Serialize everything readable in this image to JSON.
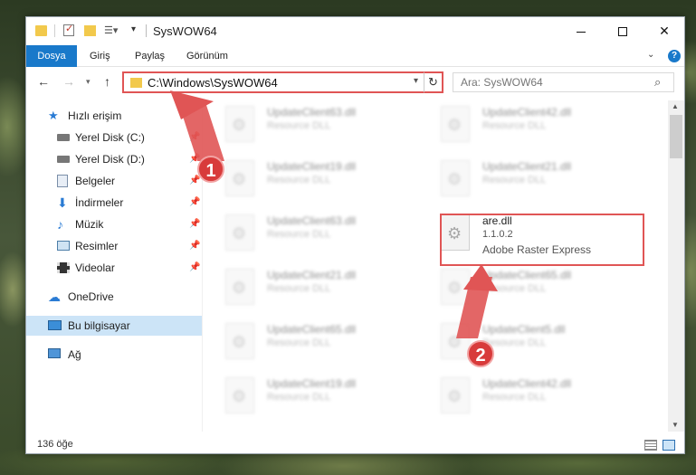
{
  "window": {
    "title": "SysWOW64",
    "controls": {
      "minimize": "—",
      "maximize": "☐",
      "close": "✕"
    }
  },
  "ribbon": {
    "tabs": [
      "Dosya",
      "Giriş",
      "Paylaş",
      "Görünüm"
    ],
    "collapse": "⌄",
    "help": "?"
  },
  "address": {
    "path": "C:\\Windows\\SysWOW64",
    "search_placeholder": "Ara: SysWOW64"
  },
  "sidebar": {
    "items": [
      {
        "label": "Hızlı erişim",
        "icon": "star-icon"
      },
      {
        "label": "Yerel Disk (C:)",
        "icon": "drive-icon",
        "pinned": true
      },
      {
        "label": "Yerel Disk (D:)",
        "icon": "drive-icon",
        "pinned": true
      },
      {
        "label": "Belgeler",
        "icon": "documents-icon",
        "pinned": true
      },
      {
        "label": "İndirmeler",
        "icon": "downloads-icon",
        "pinned": true
      },
      {
        "label": "Müzik",
        "icon": "music-icon",
        "pinned": true
      },
      {
        "label": "Resimler",
        "icon": "pictures-icon",
        "pinned": true
      },
      {
        "label": "Videolar",
        "icon": "videos-icon",
        "pinned": true
      },
      {
        "label": "OneDrive",
        "icon": "cloud-icon"
      },
      {
        "label": "Bu bilgisayar",
        "icon": "computer-icon",
        "selected": true
      },
      {
        "label": "Ağ",
        "icon": "network-icon"
      }
    ]
  },
  "files": [
    {
      "name": "UpdateClient63.dll",
      "sub": "Resource DLL"
    },
    {
      "name": "UpdateClient42.dll",
      "sub": "Resource DLL"
    },
    {
      "name": "UpdateClient19.dll",
      "sub": "Resource DLL"
    },
    {
      "name": "UpdateClient21.dll",
      "sub": "Resource DLL"
    },
    {
      "name": "UpdateClient63.dll",
      "sub": "Resource DLL"
    },
    {
      "name": "are.dll",
      "sub": "1.1.0.2",
      "desc": "Adobe Raster Express"
    },
    {
      "name": "UpdateClient21.dll",
      "sub": "Resource DLL"
    },
    {
      "name": "UpdateClient65.dll",
      "sub": "Resource DLL"
    },
    {
      "name": "UpdateClient65.dll",
      "sub": "Resource DLL"
    },
    {
      "name": "UpdateClient5.dll",
      "sub": "Resource DLL"
    },
    {
      "name": "UpdateClient19.dll",
      "sub": "Resource DLL"
    },
    {
      "name": "UpdateClient42.dll",
      "sub": "Resource DLL"
    }
  ],
  "status": {
    "count": "136 öğe"
  },
  "annotations": {
    "step1": "1",
    "step2": "2"
  }
}
